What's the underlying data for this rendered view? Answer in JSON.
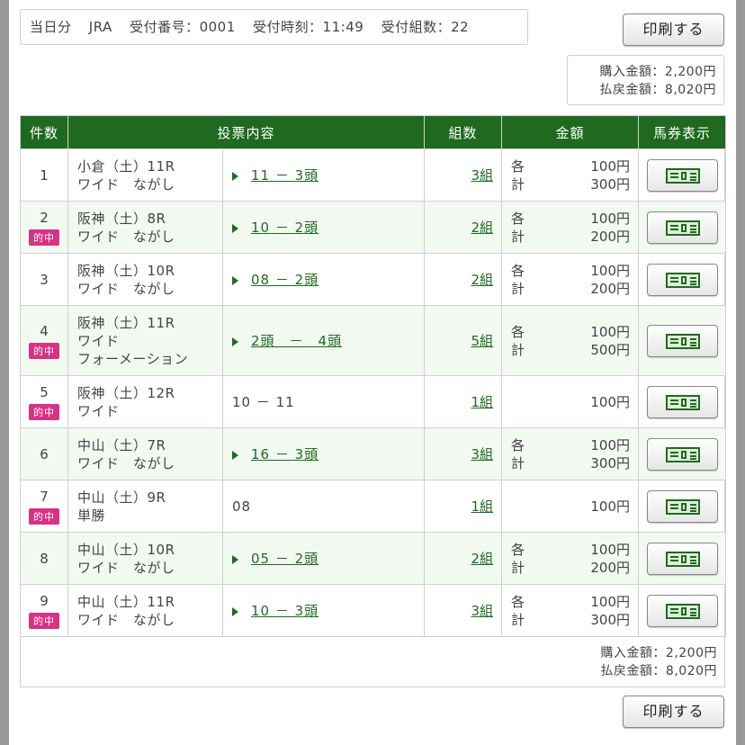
{
  "header": {
    "day": "当日分",
    "org": "JRA",
    "receipt_no": "受付番号：0001",
    "receipt_time": "受付時刻：11:49",
    "receipt_groups": "受付組数：22",
    "print_label": "印刷する"
  },
  "totals": {
    "purchase": "購入金額：2,200円",
    "payout": "払戻金額：8,020円"
  },
  "table": {
    "headers": [
      "件数",
      "投票内容",
      "組数",
      "金額",
      "馬券表示"
    ],
    "hit_label": "的中",
    "each_label": "各",
    "total_label": "計",
    "rows": [
      {
        "num": "1",
        "hit": false,
        "race": "小倉（土）11R",
        "type": "ワイド　ながし",
        "type2": "",
        "combo": "11 － 3頭",
        "combo_link": true,
        "count": "3組",
        "each": "100円",
        "total": "300円"
      },
      {
        "num": "2",
        "hit": true,
        "race": "阪神（土）8R",
        "type": "ワイド　ながし",
        "type2": "",
        "combo": "10 － 2頭",
        "combo_link": true,
        "count": "2組",
        "each": "100円",
        "total": "200円"
      },
      {
        "num": "3",
        "hit": false,
        "race": "阪神（土）10R",
        "type": "ワイド　ながし",
        "type2": "",
        "combo": "08 － 2頭",
        "combo_link": true,
        "count": "2組",
        "each": "100円",
        "total": "200円"
      },
      {
        "num": "4",
        "hit": true,
        "race": "阪神（土）11R",
        "type": "ワイド",
        "type2": "フォーメーション",
        "combo": "2頭　－　4頭",
        "combo_link": true,
        "count": "5組",
        "each": "100円",
        "total": "500円"
      },
      {
        "num": "5",
        "hit": true,
        "race": "阪神（土）12R",
        "type": "ワイド",
        "type2": "",
        "combo": "10 － 11",
        "combo_link": false,
        "count": "1組",
        "each": "",
        "total": "100円"
      },
      {
        "num": "6",
        "hit": false,
        "race": "中山（土）7R",
        "type": "ワイド　ながし",
        "type2": "",
        "combo": "16 － 3頭",
        "combo_link": true,
        "count": "3組",
        "each": "100円",
        "total": "300円"
      },
      {
        "num": "7",
        "hit": true,
        "race": "中山（土）9R",
        "type": "単勝",
        "type2": "",
        "combo": "08",
        "combo_link": false,
        "count": "1組",
        "each": "",
        "total": "100円"
      },
      {
        "num": "8",
        "hit": false,
        "race": "中山（土）10R",
        "type": "ワイド　ながし",
        "type2": "",
        "combo": "05 － 2頭",
        "combo_link": true,
        "count": "2組",
        "each": "100円",
        "total": "200円"
      },
      {
        "num": "9",
        "hit": true,
        "race": "中山（土）11R",
        "type": "ワイド　ながし",
        "type2": "",
        "combo": "10 － 3頭",
        "combo_link": true,
        "count": "3組",
        "each": "100円",
        "total": "300円"
      }
    ]
  },
  "icons": {
    "ticket": "ticket-icon",
    "arrow": "play-triangle-icon"
  },
  "colors": {
    "header_green": "#1f6a20",
    "hit_pink": "#d63384",
    "stripe": "#f1f9f1"
  }
}
